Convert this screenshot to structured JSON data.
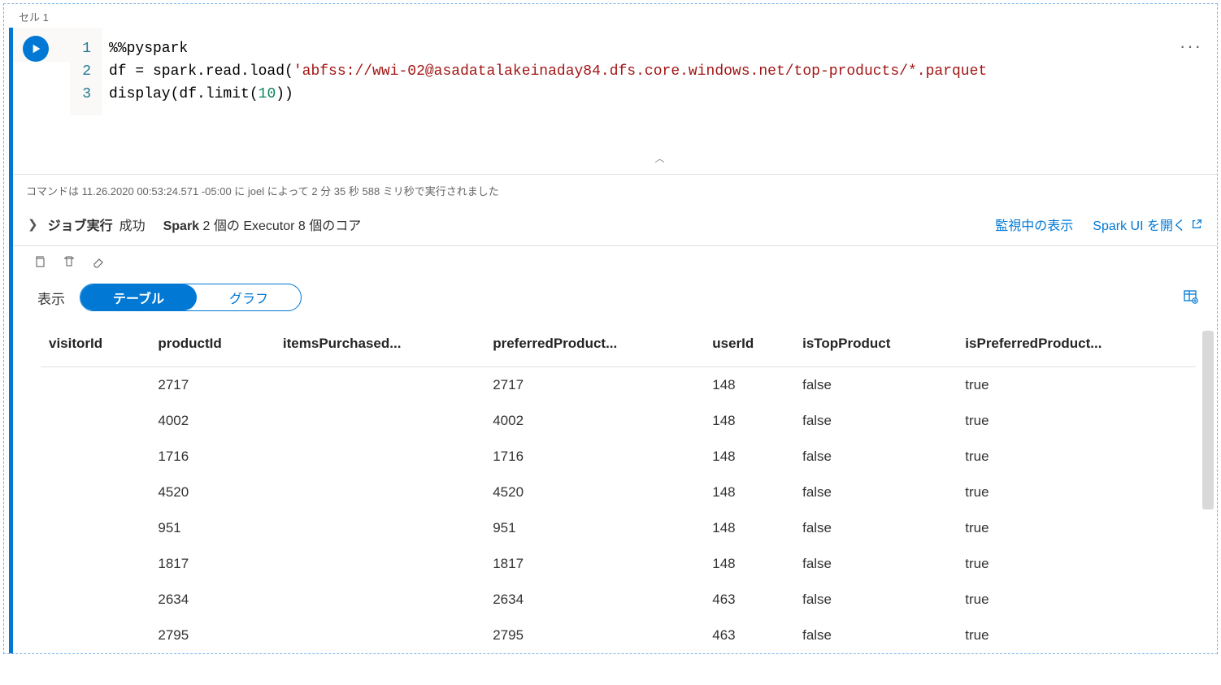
{
  "cell": {
    "label": "セル 1",
    "code": {
      "lines": [
        "1",
        "2",
        "3"
      ],
      "l1_magic": "%%pyspark",
      "l2_a": "df = spark.read.load(",
      "l2_str": "'abfss://wwi-02@asadatalakeinaday84.dfs.core.windows.net/top-products/*.parquet",
      "l3_a": "display(df.limit(",
      "l3_num": "10",
      "l3_b": "))"
    }
  },
  "status": "コマンドは 11.26.2020 00:53:24.571 -05:00 に joel によって 2 分 35 秒 588 ミリ秒で実行されました",
  "job": {
    "label": "ジョブ実行",
    "result": "成功",
    "spark_name": "Spark",
    "spark_detail": " 2 個の Executor 8 個のコア",
    "monitor_link": "監視中の表示",
    "sparkui_link": "Spark UI を開く"
  },
  "view": {
    "label": "表示",
    "table": "テーブル",
    "chart": "グラフ"
  },
  "table": {
    "headers": [
      "visitorId",
      "productId",
      "itemsPurchased...",
      "preferredProduct...",
      "userId",
      "isTopProduct",
      "isPreferredProduct..."
    ],
    "rows": [
      [
        "",
        "2717",
        "",
        "2717",
        "148",
        "false",
        "true"
      ],
      [
        "",
        "4002",
        "",
        "4002",
        "148",
        "false",
        "true"
      ],
      [
        "",
        "1716",
        "",
        "1716",
        "148",
        "false",
        "true"
      ],
      [
        "",
        "4520",
        "",
        "4520",
        "148",
        "false",
        "true"
      ],
      [
        "",
        "951",
        "",
        "951",
        "148",
        "false",
        "true"
      ],
      [
        "",
        "1817",
        "",
        "1817",
        "148",
        "false",
        "true"
      ],
      [
        "",
        "2634",
        "",
        "2634",
        "463",
        "false",
        "true"
      ],
      [
        "",
        "2795",
        "",
        "2795",
        "463",
        "false",
        "true"
      ]
    ]
  }
}
